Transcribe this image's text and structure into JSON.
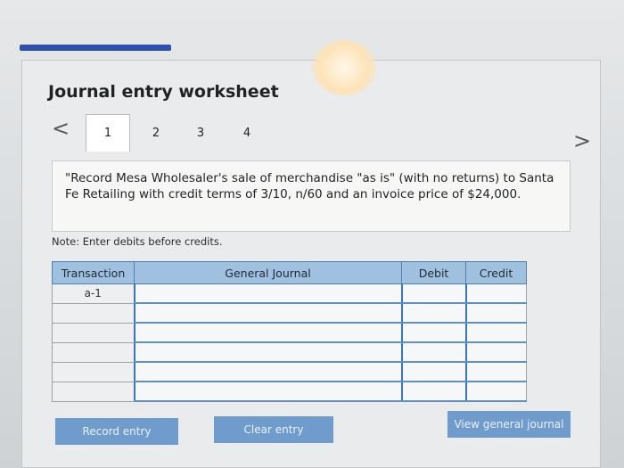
{
  "worksheet": {
    "title": "Journal entry worksheet",
    "tabs": [
      {
        "label": "1",
        "active": true
      },
      {
        "label": "2",
        "active": false
      },
      {
        "label": "3",
        "active": false
      },
      {
        "label": "4",
        "active": false
      }
    ],
    "prev_icon": "<",
    "next_icon": ">"
  },
  "question": {
    "text": "\"Record Mesa Wholesaler's sale of merchandise \"as is\" (with no returns) to Santa Fe Retailing with credit terms of 3/10, n/60 and an invoice price of $24,000."
  },
  "note": "Note: Enter debits before credits.",
  "table": {
    "headers": [
      "Transaction",
      "General Journal",
      "Debit",
      "Credit"
    ],
    "transaction_label": "a-1"
  },
  "buttons": {
    "record": "Record entry",
    "clear": "Clear entry",
    "view": "View general journal"
  },
  "colors": {
    "header_bg": "#9fc1df",
    "button_bg": "#6f9ccd",
    "top_bar": "#2f4fa8"
  }
}
